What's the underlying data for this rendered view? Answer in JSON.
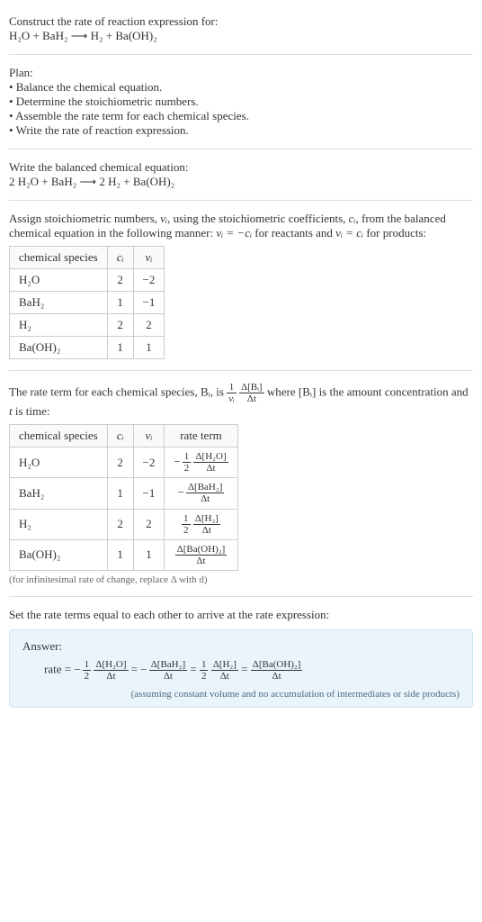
{
  "header": {
    "line1": "Construct the rate of reaction expression for:",
    "equation": "H₂O + BaH₂  ⟶  H₂ + Ba(OH)₂"
  },
  "plan": {
    "title": "Plan:",
    "b1": "• Balance the chemical equation.",
    "b2": "• Determine the stoichiometric numbers.",
    "b3": "• Assemble the rate term for each chemical species.",
    "b4": "• Write the rate of reaction expression."
  },
  "balanced": {
    "title": "Write the balanced chemical equation:",
    "equation": "2 H₂O + BaH₂  ⟶  2 H₂ + Ba(OH)₂"
  },
  "stoich_intro": {
    "part1": "Assign stoichiometric numbers, ",
    "nu_i": "νᵢ",
    "part2": ", using the stoichiometric coefficients, ",
    "c_i": "cᵢ",
    "part3": ", from the balanced chemical equation in the following manner: ",
    "rel_reactants": "νᵢ = −cᵢ",
    "part4": " for reactants and ",
    "rel_products": "νᵢ = cᵢ",
    "part5": " for products:"
  },
  "table1": {
    "h1": "chemical species",
    "h2": "cᵢ",
    "h3": "νᵢ",
    "r1c1": "H₂O",
    "r1c2": "2",
    "r1c3": "−2",
    "r2c1": "BaH₂",
    "r2c2": "1",
    "r2c3": "−1",
    "r3c1": "H₂",
    "r3c2": "2",
    "r3c3": "2",
    "r4c1": "Ba(OH)₂",
    "r4c2": "1",
    "r4c3": "1"
  },
  "rate_intro": {
    "part1": "The rate term for each chemical species, ",
    "Bi": "Bᵢ",
    "part2": ", is ",
    "frac1_num": "1",
    "frac1_den": "νᵢ",
    "frac2_num": "Δ[Bᵢ]",
    "frac2_den": "Δt",
    "part3": " where [Bᵢ] is the amount concentration and ",
    "t": "t",
    "part4": " is time:"
  },
  "table2": {
    "h1": "chemical species",
    "h2": "cᵢ",
    "h3": "νᵢ",
    "h4": "rate term",
    "r1": {
      "sp": "H₂O",
      "c": "2",
      "nu": "−2",
      "sign": "−",
      "coef_num": "1",
      "coef_den": "2",
      "dnum": "Δ[H₂O]",
      "dden": "Δt"
    },
    "r2": {
      "sp": "BaH₂",
      "c": "1",
      "nu": "−1",
      "sign": "−",
      "dnum": "Δ[BaH₂]",
      "dden": "Δt"
    },
    "r3": {
      "sp": "H₂",
      "c": "2",
      "nu": "2",
      "coef_num": "1",
      "coef_den": "2",
      "dnum": "Δ[H₂]",
      "dden": "Δt"
    },
    "r4": {
      "sp": "Ba(OH)₂",
      "c": "1",
      "nu": "1",
      "dnum": "Δ[Ba(OH)₂]",
      "dden": "Δt"
    }
  },
  "infinitesimal_note": "(for infinitesimal rate of change, replace Δ with d)",
  "set_equal": "Set the rate terms equal to each other to arrive at the rate expression:",
  "answer": {
    "label": "Answer:",
    "rate_eq_prefix": "rate = ",
    "neg": "−",
    "half_num": "1",
    "half_den": "2",
    "t1_num": "Δ[H₂O]",
    "t1_den": "Δt",
    "eq": " = ",
    "t2_num": "Δ[BaH₂]",
    "t2_den": "Δt",
    "t3_num": "Δ[H₂]",
    "t3_den": "Δt",
    "t4_num": "Δ[Ba(OH)₂]",
    "t4_den": "Δt",
    "assume": "(assuming constant volume and no accumulation of intermediates or side products)"
  },
  "chart_data": {
    "type": "table",
    "tables": [
      {
        "columns": [
          "chemical species",
          "c_i",
          "nu_i"
        ],
        "rows": [
          [
            "H2O",
            2,
            -2
          ],
          [
            "BaH2",
            1,
            -1
          ],
          [
            "H2",
            2,
            2
          ],
          [
            "Ba(OH)2",
            1,
            1
          ]
        ]
      },
      {
        "columns": [
          "chemical species",
          "c_i",
          "nu_i",
          "rate term"
        ],
        "rows": [
          [
            "H2O",
            2,
            -2,
            "-(1/2) Δ[H2O]/Δt"
          ],
          [
            "BaH2",
            1,
            -1,
            "-Δ[BaH2]/Δt"
          ],
          [
            "H2",
            2,
            2,
            "(1/2) Δ[H2]/Δt"
          ],
          [
            "Ba(OH)2",
            1,
            1,
            "Δ[Ba(OH)2]/Δt"
          ]
        ]
      }
    ],
    "rate_expression": "rate = -(1/2) Δ[H2O]/Δt = -Δ[BaH2]/Δt = (1/2) Δ[H2]/Δt = Δ[Ba(OH)2]/Δt"
  }
}
